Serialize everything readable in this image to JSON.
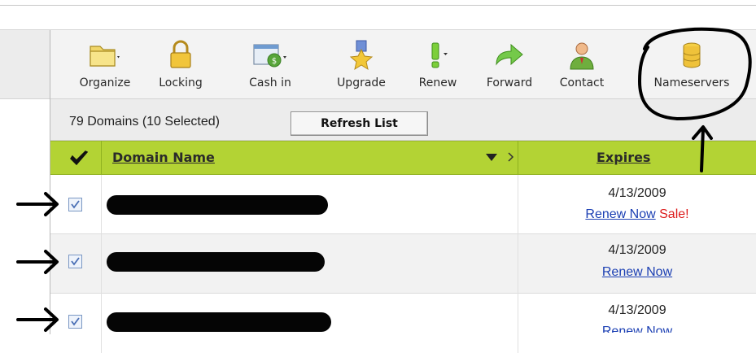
{
  "toolbar": {
    "items": [
      {
        "label": "Organize",
        "icon": "folder-icon",
        "has_dropdown": true
      },
      {
        "label": "Locking",
        "icon": "padlock-icon",
        "has_dropdown": false
      },
      {
        "label": "Cash in",
        "icon": "cash-in-icon",
        "has_dropdown": true
      },
      {
        "label": "Upgrade",
        "icon": "medal-icon",
        "has_dropdown": false
      },
      {
        "label": "Renew",
        "icon": "exclamation-icon",
        "has_dropdown": true
      },
      {
        "label": "Forward",
        "icon": "forward-arrow-icon",
        "has_dropdown": false
      },
      {
        "label": "Contact",
        "icon": "person-icon",
        "has_dropdown": false
      },
      {
        "label": "Nameservers",
        "icon": "database-icon",
        "has_dropdown": false
      }
    ]
  },
  "list": {
    "count_text": "79 Domains (10 Selected)",
    "refresh_label": "Refresh List"
  },
  "table": {
    "columns": {
      "domain": "Domain Name",
      "expires": "Expires"
    },
    "rows": [
      {
        "checked": true,
        "expires": "4/13/2009",
        "renew_label": "Renew Now",
        "sale_label": "Sale!"
      },
      {
        "checked": true,
        "expires": "4/13/2009",
        "renew_label": "Renew Now",
        "sale_label": ""
      },
      {
        "checked": true,
        "expires": "4/13/2009",
        "renew_label": "Renew Now",
        "sale_label": ""
      }
    ]
  },
  "colors": {
    "header_green": "#b3d334",
    "link_blue": "#1b3fb3",
    "sale_red": "#dd1a1a",
    "annotation_ink": "#000000"
  }
}
